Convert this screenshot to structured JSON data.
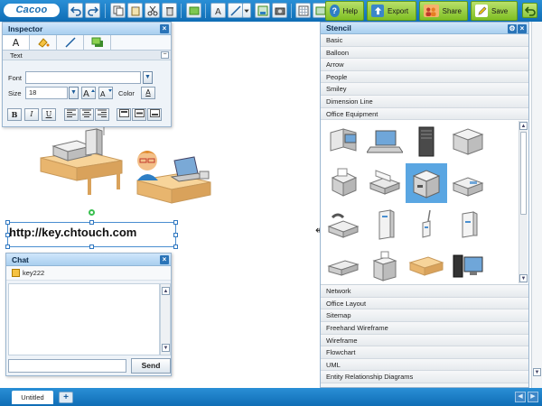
{
  "toolbar": {
    "logo": "Cacoo",
    "actions": {
      "help": "Help",
      "export": "Export",
      "share": "Share",
      "save": "Save"
    }
  },
  "inspector": {
    "title": "Inspector",
    "section": "Text",
    "font_label": "Font",
    "font_value": "",
    "size_label": "Size",
    "size_value": "18",
    "color_label": "Color",
    "format_buttons": [
      "B",
      "I",
      "U"
    ],
    "color_glyph": "A",
    "text_tab_glyph": "A"
  },
  "canvas": {
    "text_shape": "http://key.chtouch.com"
  },
  "chat": {
    "title": "Chat",
    "user": "key222",
    "send_label": "Send",
    "input_value": ""
  },
  "stencil": {
    "title": "Stencil",
    "categories_top": [
      "Basic",
      "Balloon",
      "Arrow",
      "People",
      "Smiley",
      "Dimension Line",
      "Office Equipment"
    ],
    "categories_bottom": [
      "Network",
      "Office Layout",
      "Sitemap",
      "Freehand Wireframe",
      "Wireframe",
      "Flowchart",
      "UML",
      "Entity Relationship Diagrams"
    ]
  },
  "sheets": {
    "active": "Untitled",
    "add_glyph": "+"
  },
  "colors": {
    "toolbar": "#1478c4",
    "accent_green": "#8cc63f",
    "panel_header": "#b9dbf6",
    "selection": "#5aa6e2"
  }
}
